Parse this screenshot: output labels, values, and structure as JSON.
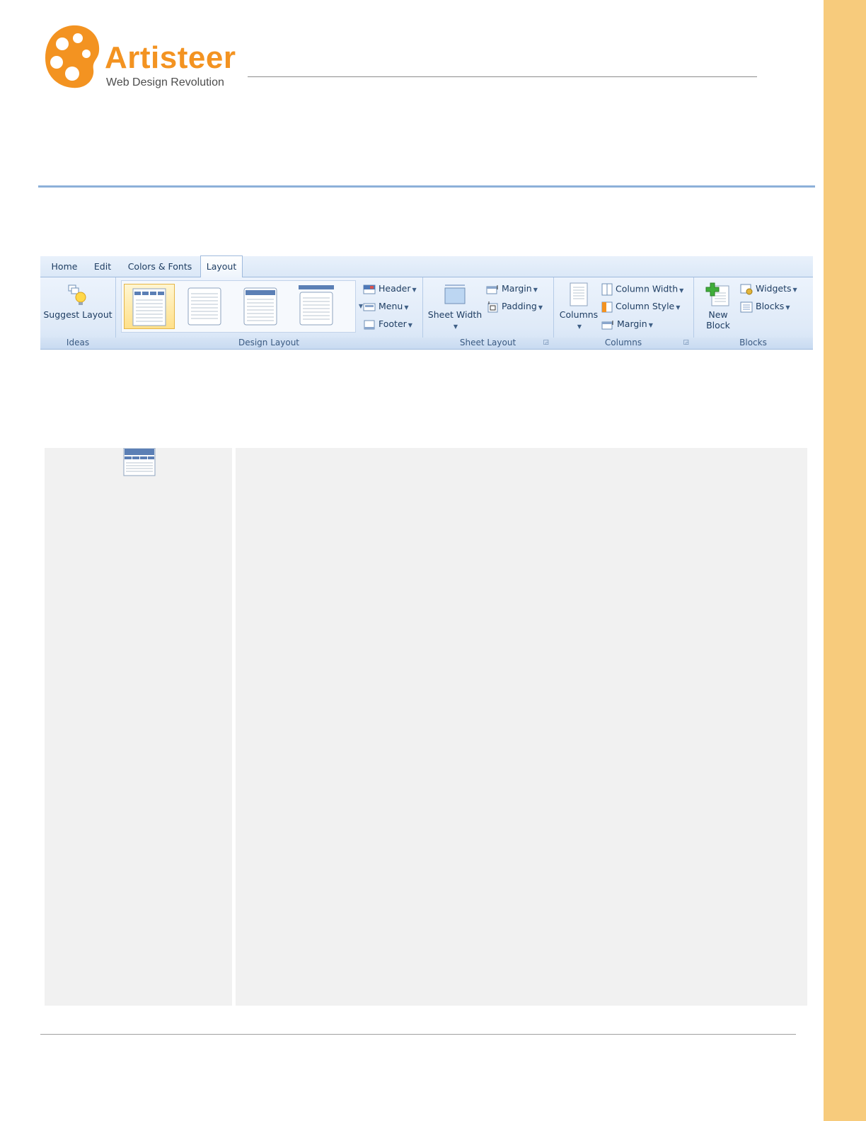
{
  "logo": {
    "name": "Artisteer",
    "tagline": "Web Design Revolution"
  },
  "colors": {
    "accent_orange": "#f39321",
    "sidebar": "#f7cb7c",
    "rule_blue": "#8cb0d9",
    "panel": "#f1f1f1",
    "ribbon_text": "#1e3d62"
  },
  "ribbon": {
    "tabs": [
      {
        "label": "Home",
        "active": false
      },
      {
        "label": "Edit",
        "active": false
      },
      {
        "label": "Colors & Fonts",
        "active": false
      },
      {
        "label": "Layout",
        "active": true
      }
    ],
    "groups": {
      "ideas": {
        "label": "Ideas",
        "suggest_layout": "Suggest Layout",
        "icon": "lightbulb-icon"
      },
      "design_layout": {
        "label": "Design Layout",
        "gallery_items": [
          "menu-top-layout",
          "plain-layout",
          "header-menu-layout",
          "bar-top-layout"
        ],
        "header": "Header",
        "menu": "Menu",
        "footer": "Footer"
      },
      "sheet_layout": {
        "label": "Sheet Layout",
        "sheet_width": "Sheet Width",
        "margin": "Margin",
        "padding": "Padding"
      },
      "columns": {
        "label": "Columns",
        "columns": "Columns",
        "column_width": "Column Width",
        "column_style": "Column Style",
        "margin": "Margin"
      },
      "blocks": {
        "label": "Blocks",
        "new_block_line1": "New",
        "new_block_line2": "Block",
        "widgets": "Widgets",
        "blocks": "Blocks"
      }
    }
  }
}
